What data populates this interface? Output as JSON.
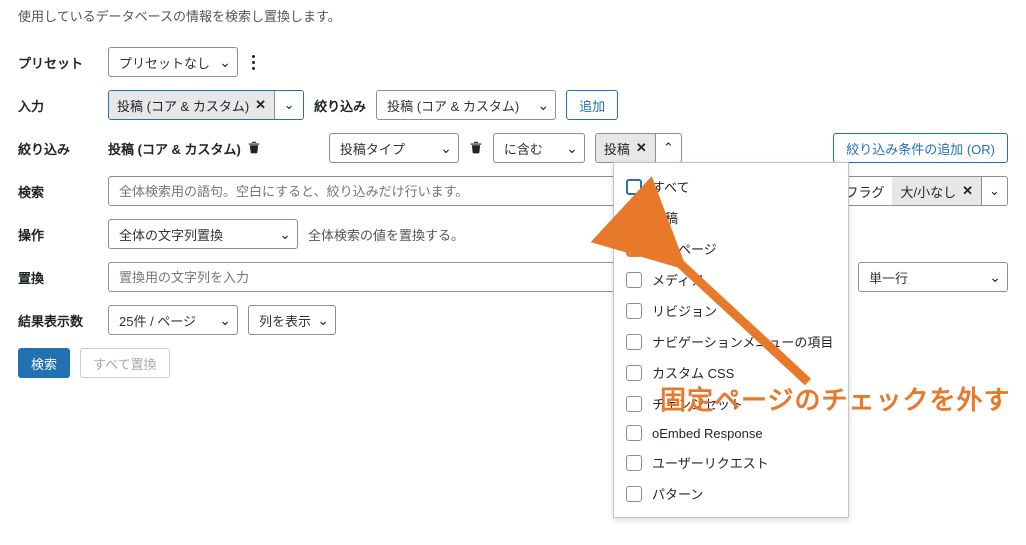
{
  "description": "使用しているデータベースの情報を検索し置換します。",
  "labels": {
    "preset": "プリセット",
    "input": "入力",
    "filter": "絞り込み",
    "search": "検索",
    "operation": "操作",
    "replace": "置換",
    "result_count": "結果表示数",
    "filter_inline": "絞り込み"
  },
  "preset": {
    "value": "プリセットなし"
  },
  "input_tag": "投稿 (コア & カスタム)",
  "filter_select": "投稿 (コア & カスタム)",
  "add_btn": "追加",
  "filter_row": {
    "title": "投稿 (コア & カスタム)",
    "type_select": "投稿タイプ",
    "contains_select": "に含む",
    "value_chip": "投稿",
    "add_or": "絞り込み条件の追加 (OR)"
  },
  "search_placeholder": "全体検索用の語句。空白にすると、絞り込みだけ行います。",
  "flag": {
    "label": "フラグ",
    "chip": "大/小なし"
  },
  "operation_select": "全体の文字列置換",
  "operation_hint": "全体検索の値を置換する。",
  "replace_placeholder": "置換用の文字列を入力",
  "replace_mode": "単一行",
  "perpage": "25件 / ページ",
  "cols_btn": "列を表示",
  "search_btn": "検索",
  "replace_all_btn": "すべて置換",
  "dropdown_items": [
    {
      "label": "すべて",
      "state": "focus"
    },
    {
      "label": "投稿",
      "state": "checked"
    },
    {
      "label": "固定ページ",
      "state": "highlight"
    },
    {
      "label": "メディア",
      "state": ""
    },
    {
      "label": "リビジョン",
      "state": ""
    },
    {
      "label": "ナビゲーションメニューの項目",
      "state": ""
    },
    {
      "label": "カスタム CSS",
      "state": ""
    },
    {
      "label": "チェンジセット",
      "state": ""
    },
    {
      "label": "oEmbed Response",
      "state": ""
    },
    {
      "label": "ユーザーリクエスト",
      "state": ""
    },
    {
      "label": "パターン",
      "state": ""
    }
  ],
  "annotation_text": "固定ページのチェックを外す"
}
